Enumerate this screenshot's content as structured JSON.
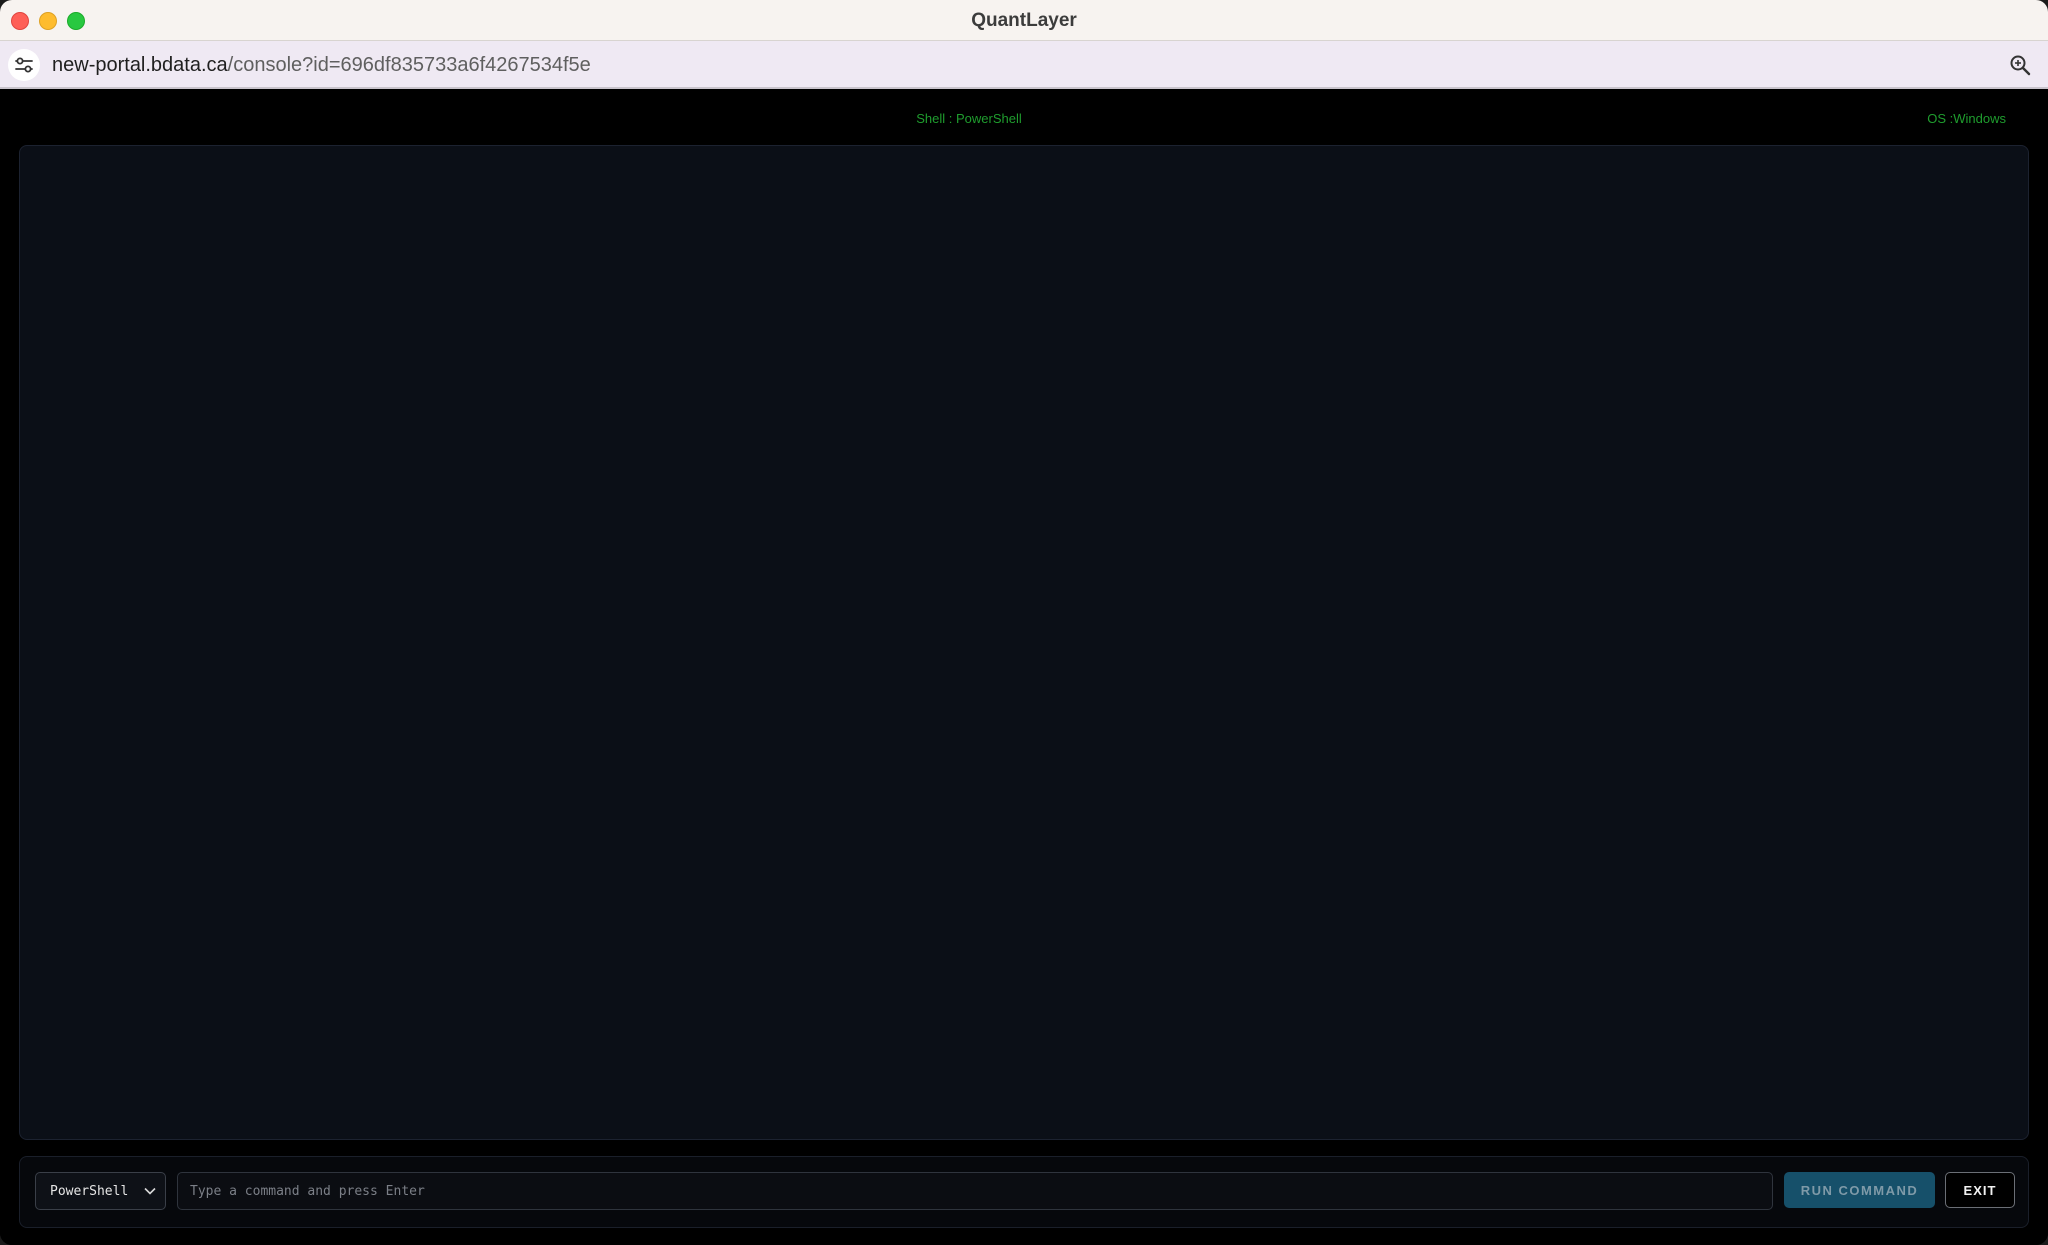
{
  "window": {
    "title": "QuantLayer"
  },
  "address_bar": {
    "url_host": "new-portal.bdata.ca",
    "url_path": "/console?id=696df835733a6f4267534f5e"
  },
  "console": {
    "shell_label": "Shell : PowerShell",
    "os_label": "OS :Windows"
  },
  "command_bar": {
    "shell_selected": "PowerShell",
    "input_placeholder": "Type a command and press Enter",
    "run_label": "RUN COMMAND",
    "exit_label": "EXIT"
  },
  "colors": {
    "accent_green": "#1f9d2e",
    "run_button": "#16506a",
    "output_bg": "#0b0f17"
  },
  "icons": {
    "site_info": "site-settings-icon",
    "zoom": "zoom-icon",
    "select": "chevron-down-icon"
  }
}
